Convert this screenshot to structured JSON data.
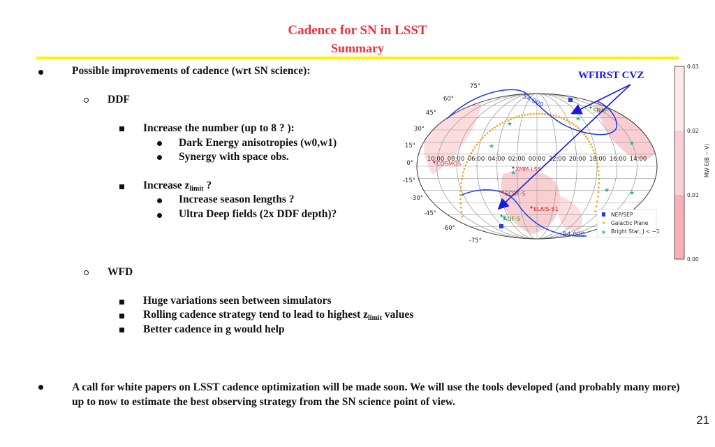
{
  "slide": {
    "title_line1": "Cadence for SN in LSST",
    "title_line2": "Summary",
    "page_number": "21",
    "colors": {
      "title": "#e8333c",
      "rule": "#fff200",
      "annotation": "#1a1adf"
    }
  },
  "bullets": {
    "b1": "Possible improvements of cadence (wrt SN science):",
    "ddf": "DDF",
    "ddf_1": "Increase the number (up to 8 ? ):",
    "ddf_1_1": "Dark Energy anisotropies (w0,w1)",
    "ddf_1_2": "Synergy with space obs.",
    "ddf_2_pre": "Increase z",
    "ddf_2_sub": "limit",
    "ddf_2_post": " ?",
    "ddf_2_1": "Increase season lengths ?",
    "ddf_2_2": "Ultra Deep fields (2x DDF depth)?",
    "wfd": "WFD",
    "wfd_1": "Huge variations seen between simulators",
    "wfd_2_pre": "Rolling cadence strategy tend to lead to highest z",
    "wfd_2_sub": "limit",
    "wfd_2_post": " values",
    "wfd_3": "Better cadence in g would help",
    "b2": "A call for white papers on LSST cadence optimization will be made soon. We will use the tools developed (and probably many more) up to now to estimate the best observing strategy from the SN science point of view."
  },
  "figure": {
    "annotation": "WFIRST CVZ",
    "dec_labels": [
      "75°",
      "60°",
      "45°",
      "30°",
      "15°",
      "0°",
      "-15°",
      "-30°",
      "-45°",
      "-60°",
      "-75°"
    ],
    "ra_labels": [
      "10:00",
      "08:00",
      "06:00",
      "04:00",
      "02:00",
      "00:00",
      "22:00",
      "20:00",
      "18:00",
      "16:00",
      "14:00"
    ],
    "contour_label": "54.000",
    "fields": [
      {
        "name": "COSMOS",
        "color": "#e02020"
      },
      {
        "name": "XMM-LSS",
        "color": "#e02020"
      },
      {
        "name": "ECDF-S",
        "color": "#e02020"
      },
      {
        "name": "ELAIS-S1",
        "color": "#e02020"
      },
      {
        "name": "ADF-S",
        "color": "#2a8a2a"
      },
      {
        "name": "SNAP",
        "color": "#2a8a2a"
      }
    ],
    "legend": [
      {
        "label": "NEP/SEP",
        "color": "#1a3fe0"
      },
      {
        "label": "Galactic Plane",
        "color": "#f5a623"
      },
      {
        "label": "Bright Star, J < −1",
        "color": "#20b2aa"
      }
    ],
    "colorbar": {
      "label": "MW E(B − V)",
      "ticks": [
        "0.03",
        "0.02",
        "0.01",
        "0.00"
      ],
      "colors": [
        "#fde8ea",
        "#fbd0d4",
        "#f8b0b6"
      ]
    }
  }
}
